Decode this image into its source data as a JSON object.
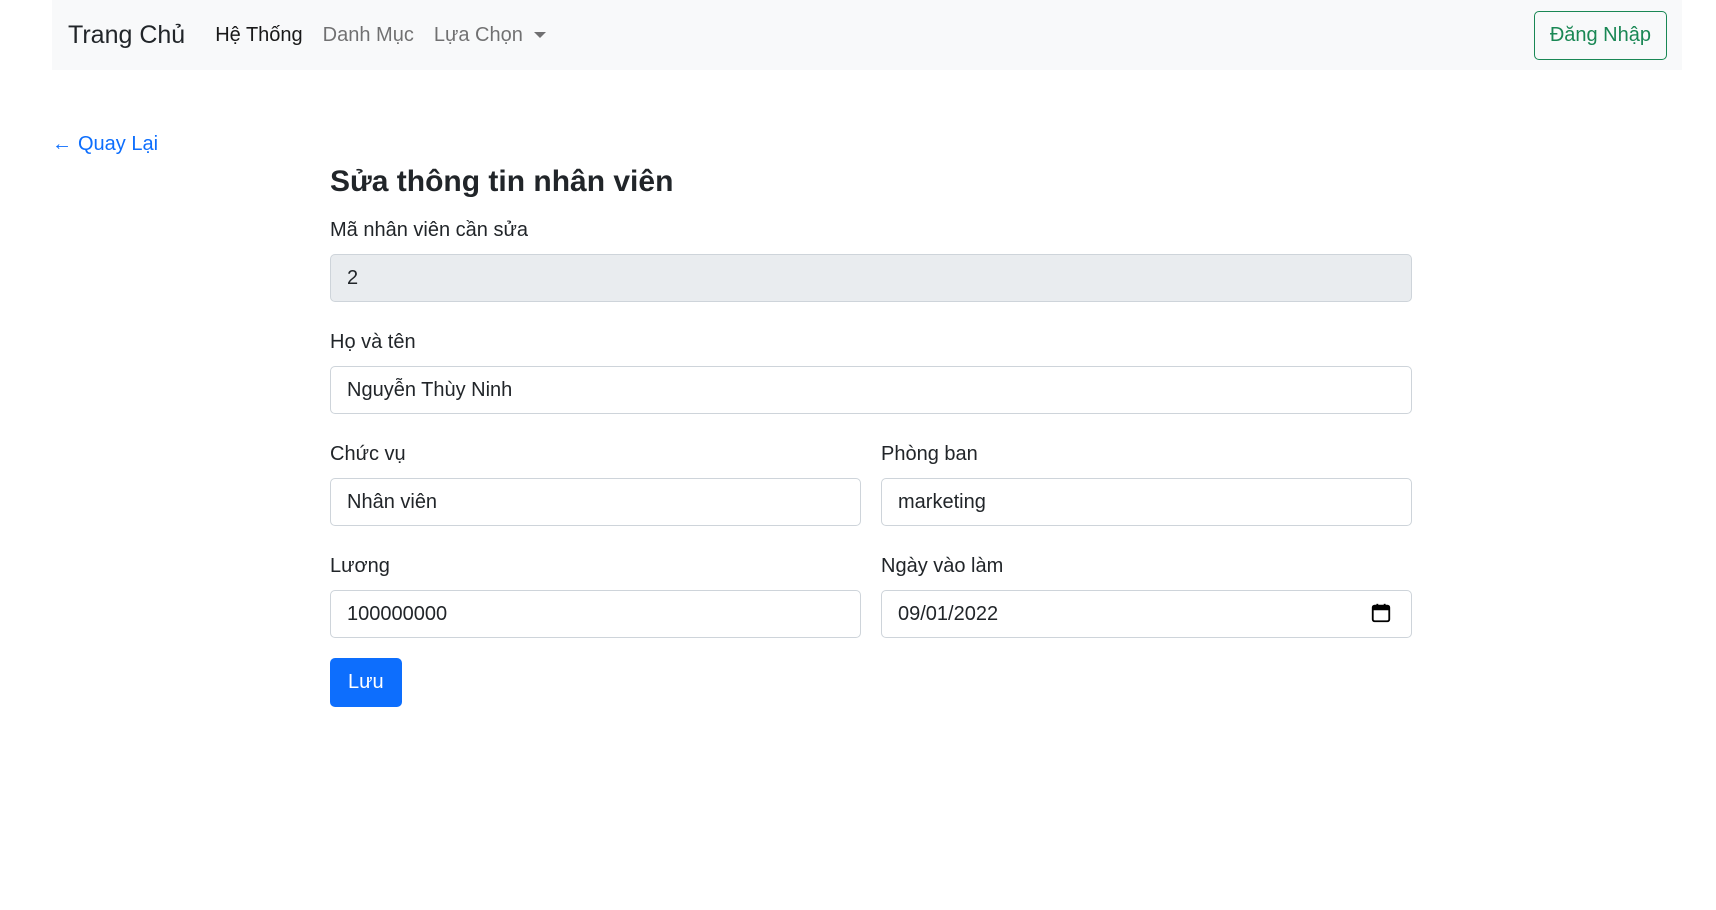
{
  "navbar": {
    "brand": "Trang Chủ",
    "links": [
      "Hệ Thống",
      "Danh Mục",
      "Lựa Chọn"
    ],
    "login_label": "Đăng Nhập"
  },
  "back": {
    "arrow": "←",
    "label": "Quay Lại"
  },
  "form": {
    "title": "Sửa thông tin nhân viên",
    "id_label": "Mã nhân viên cần sửa",
    "id_value": "2",
    "name_label": "Họ và tên",
    "name_value": "Nguyễn Thùy Ninh",
    "position_label": "Chức vụ",
    "position_value": "Nhân viên",
    "department_label": "Phòng ban",
    "department_value": "marketing",
    "salary_label": "Lương",
    "salary_value": "100000000",
    "start_date_label": "Ngày vào làm",
    "start_date_value": "09/01/2022",
    "save_label": "Lưu"
  },
  "colors": {
    "primary": "#0d6efd",
    "success": "#198754",
    "navbar_bg": "#f8f9fa",
    "disabled_bg": "#e9ecef"
  },
  "icons": {
    "date_picker": "calendar-icon",
    "dropdown": "caret-down-icon",
    "back": "arrow-left-icon"
  }
}
